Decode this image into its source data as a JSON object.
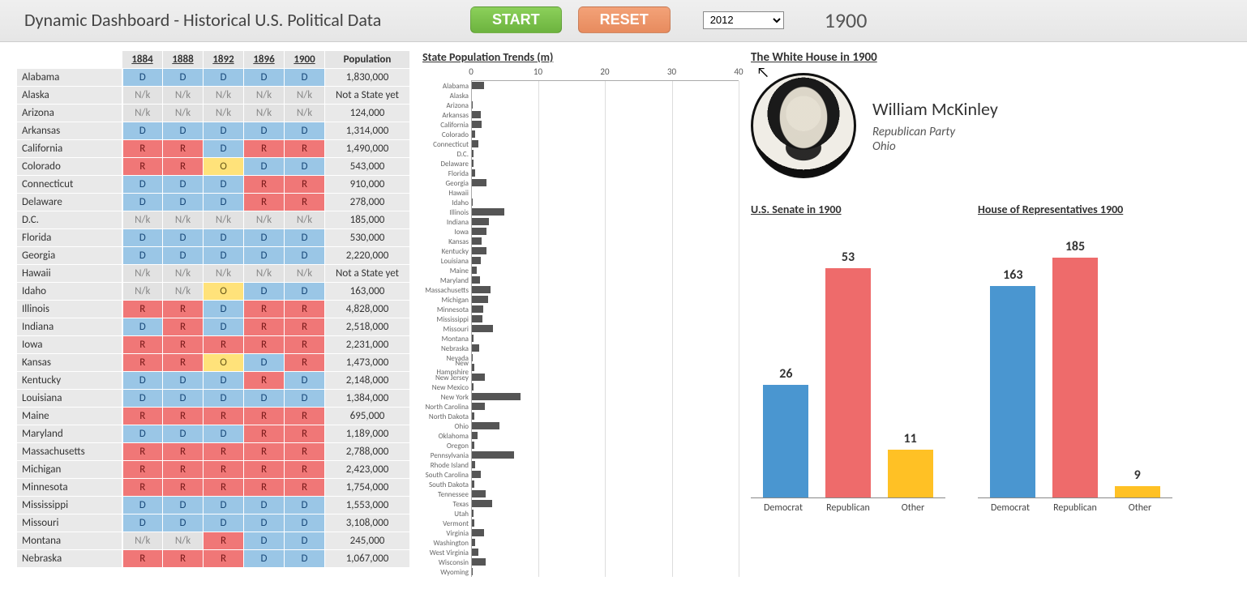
{
  "header": {
    "title": "Dynamic Dashboard - Historical U.S. Political Data",
    "start_label": "START",
    "reset_label": "RESET",
    "year_select_value": "2012",
    "current_year": "1900"
  },
  "table": {
    "year_headers": [
      "1884",
      "1888",
      "1892",
      "1896",
      "1900"
    ],
    "pop_header": "Population",
    "rows": [
      {
        "state": "Alabama",
        "v": [
          "D",
          "D",
          "D",
          "D",
          "D"
        ],
        "pop": "1,830,000"
      },
      {
        "state": "Alaska",
        "v": [
          "N/k",
          "N/k",
          "N/k",
          "N/k",
          "N/k"
        ],
        "pop": "Not a State yet"
      },
      {
        "state": "Arizona",
        "v": [
          "N/k",
          "N/k",
          "N/k",
          "N/k",
          "N/k"
        ],
        "pop": "124,000"
      },
      {
        "state": "Arkansas",
        "v": [
          "D",
          "D",
          "D",
          "D",
          "D"
        ],
        "pop": "1,314,000"
      },
      {
        "state": "California",
        "v": [
          "R",
          "R",
          "D",
          "R",
          "R"
        ],
        "pop": "1,490,000"
      },
      {
        "state": "Colorado",
        "v": [
          "R",
          "R",
          "O",
          "D",
          "D"
        ],
        "pop": "543,000"
      },
      {
        "state": "Connecticut",
        "v": [
          "D",
          "D",
          "D",
          "R",
          "R"
        ],
        "pop": "910,000"
      },
      {
        "state": "Delaware",
        "v": [
          "D",
          "D",
          "D",
          "R",
          "R"
        ],
        "pop": "278,000"
      },
      {
        "state": "D.C.",
        "v": [
          "N/k",
          "N/k",
          "N/k",
          "N/k",
          "N/k"
        ],
        "pop": "185,000"
      },
      {
        "state": "Florida",
        "v": [
          "D",
          "D",
          "D",
          "D",
          "D"
        ],
        "pop": "530,000"
      },
      {
        "state": "Georgia",
        "v": [
          "D",
          "D",
          "D",
          "D",
          "D"
        ],
        "pop": "2,220,000"
      },
      {
        "state": "Hawaii",
        "v": [
          "N/k",
          "N/k",
          "N/k",
          "N/k",
          "N/k"
        ],
        "pop": "Not a State yet"
      },
      {
        "state": "Idaho",
        "v": [
          "N/k",
          "N/k",
          "O",
          "D",
          "D"
        ],
        "pop": "163,000"
      },
      {
        "state": "Illinois",
        "v": [
          "R",
          "R",
          "D",
          "R",
          "R"
        ],
        "pop": "4,828,000"
      },
      {
        "state": "Indiana",
        "v": [
          "D",
          "R",
          "D",
          "R",
          "R"
        ],
        "pop": "2,518,000"
      },
      {
        "state": "Iowa",
        "v": [
          "R",
          "R",
          "R",
          "R",
          "R"
        ],
        "pop": "2,231,000"
      },
      {
        "state": "Kansas",
        "v": [
          "R",
          "R",
          "O",
          "D",
          "R"
        ],
        "pop": "1,473,000"
      },
      {
        "state": "Kentucky",
        "v": [
          "D",
          "D",
          "D",
          "R",
          "D"
        ],
        "pop": "2,148,000"
      },
      {
        "state": "Louisiana",
        "v": [
          "D",
          "D",
          "D",
          "D",
          "D"
        ],
        "pop": "1,384,000"
      },
      {
        "state": "Maine",
        "v": [
          "R",
          "R",
          "R",
          "R",
          "R"
        ],
        "pop": "695,000"
      },
      {
        "state": "Maryland",
        "v": [
          "D",
          "D",
          "D",
          "R",
          "R"
        ],
        "pop": "1,189,000"
      },
      {
        "state": "Massachusetts",
        "v": [
          "R",
          "R",
          "R",
          "R",
          "R"
        ],
        "pop": "2,788,000"
      },
      {
        "state": "Michigan",
        "v": [
          "R",
          "R",
          "R",
          "R",
          "R"
        ],
        "pop": "2,423,000"
      },
      {
        "state": "Minnesota",
        "v": [
          "R",
          "R",
          "R",
          "R",
          "R"
        ],
        "pop": "1,754,000"
      },
      {
        "state": "Mississippi",
        "v": [
          "D",
          "D",
          "D",
          "D",
          "D"
        ],
        "pop": "1,553,000"
      },
      {
        "state": "Missouri",
        "v": [
          "D",
          "D",
          "D",
          "D",
          "D"
        ],
        "pop": "3,108,000"
      },
      {
        "state": "Montana",
        "v": [
          "N/k",
          "N/k",
          "R",
          "D",
          "D"
        ],
        "pop": "245,000"
      },
      {
        "state": "Nebraska",
        "v": [
          "R",
          "R",
          "R",
          "D",
          "D"
        ],
        "pop": "1,067,000"
      }
    ]
  },
  "chart_data": [
    {
      "id": "pop_trend",
      "type": "bar",
      "title": "State Population Trends (m)",
      "orientation": "horizontal",
      "xlabel": "",
      "ylabel": "",
      "xlim": [
        0,
        40
      ],
      "xticks": [
        0,
        10,
        20,
        30,
        40
      ],
      "categories": [
        "Alabama",
        "Alaska",
        "Arizona",
        "Arkansas",
        "California",
        "Colorado",
        "Connecticut",
        "D.C.",
        "Delaware",
        "Florida",
        "Georgia",
        "Hawaii",
        "Idaho",
        "Illinois",
        "Indiana",
        "Iowa",
        "Kansas",
        "Kentucky",
        "Louisiana",
        "Maine",
        "Maryland",
        "Massachusetts",
        "Michigan",
        "Minnesota",
        "Mississippi",
        "Missouri",
        "Montana",
        "Nebraska",
        "Nevada",
        "New Hampshire",
        "New Jersey",
        "New Mexico",
        "New York",
        "North Carolina",
        "North Dakota",
        "Ohio",
        "Oklahoma",
        "Oregon",
        "Pennsylvania",
        "Rhode Island",
        "South Carolina",
        "South Dakota",
        "Tennessee",
        "Texas",
        "Utah",
        "Vermont",
        "Virginia",
        "Washington",
        "West Virginia",
        "Wisconsin",
        "Wyoming"
      ],
      "values": [
        1.83,
        0,
        0.12,
        1.31,
        1.49,
        0.54,
        0.91,
        0.19,
        0.28,
        0.53,
        2.22,
        0,
        0.16,
        4.83,
        2.52,
        2.23,
        1.47,
        2.15,
        1.38,
        0.7,
        1.19,
        2.79,
        2.42,
        1.75,
        1.55,
        3.11,
        0.25,
        1.07,
        0.04,
        0.41,
        1.88,
        0.2,
        7.27,
        1.89,
        0.32,
        4.16,
        0.79,
        0.41,
        6.3,
        0.43,
        1.34,
        0.4,
        2.02,
        3.05,
        0.28,
        0.34,
        1.85,
        0.52,
        0.96,
        2.07,
        0.09
      ]
    },
    {
      "id": "senate",
      "type": "bar",
      "title": "U.S. Senate in 1900",
      "categories": [
        "Democrat",
        "Republican",
        "Other"
      ],
      "values": [
        26,
        53,
        11
      ],
      "ylim": [
        0,
        60
      ],
      "colors": [
        "#4a96d0",
        "#ee6b6b",
        "#ffc125"
      ]
    },
    {
      "id": "house",
      "type": "bar",
      "title": "House of Representatives 1900",
      "categories": [
        "Democrat",
        "Republican",
        "Other"
      ],
      "values": [
        163,
        185,
        9
      ],
      "ylim": [
        0,
        200
      ],
      "colors": [
        "#4a96d0",
        "#ee6b6b",
        "#ffc125"
      ]
    }
  ],
  "whitehouse": {
    "heading": "The White House in 1900",
    "name": "William McKinley",
    "party": "Republican Party",
    "state": "Ohio"
  }
}
